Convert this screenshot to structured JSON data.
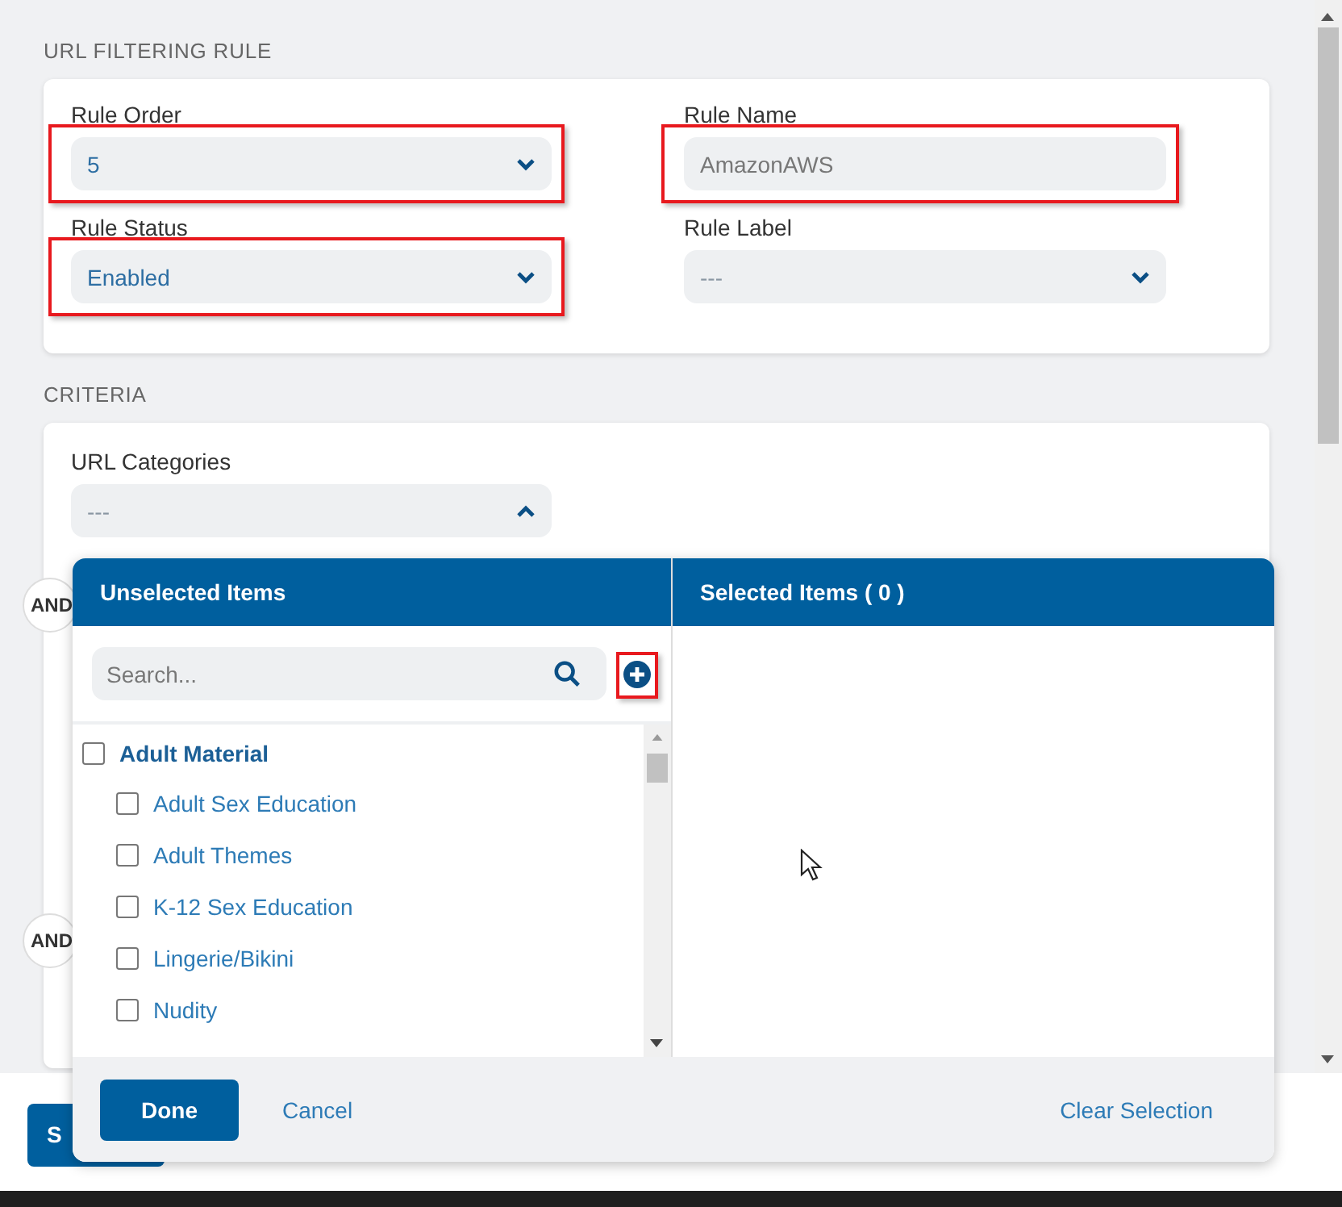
{
  "section_title": "URL FILTERING RULE",
  "rule_fields": [
    {
      "label": "Rule Order",
      "kind": "select",
      "value": "5",
      "highlighted": true
    },
    {
      "label": "Rule Name",
      "kind": "text",
      "value": "AmazonAWS",
      "highlighted": true
    },
    {
      "label": "Rule Status",
      "kind": "select",
      "value": "Enabled",
      "highlighted": true
    },
    {
      "label": "Rule Label",
      "kind": "select",
      "value": "---",
      "highlighted": false
    }
  ],
  "criteria": {
    "title": "CRITERIA",
    "field": {
      "label": "URL Categories",
      "value": "---",
      "expanded": true
    },
    "connectors": [
      "AND",
      "AND"
    ]
  },
  "picker": {
    "unselected_title": "Unselected Items",
    "selected_title": "Selected Items ( 0 )",
    "search": {
      "placeholder": "Search..."
    },
    "add_button": {
      "highlighted": true
    },
    "items": [
      {
        "label": "Adult Material",
        "checked": false,
        "children": [
          {
            "label": "Adult Sex Education",
            "checked": false
          },
          {
            "label": "Adult Themes",
            "checked": false
          },
          {
            "label": "K-12 Sex Education",
            "checked": false
          },
          {
            "label": "Lingerie/Bikini",
            "checked": false
          },
          {
            "label": "Nudity",
            "checked": false
          }
        ]
      }
    ],
    "done_button": "Done",
    "cancel_link": "Cancel",
    "clear_link": "Clear Selection"
  },
  "save_button": "S"
}
